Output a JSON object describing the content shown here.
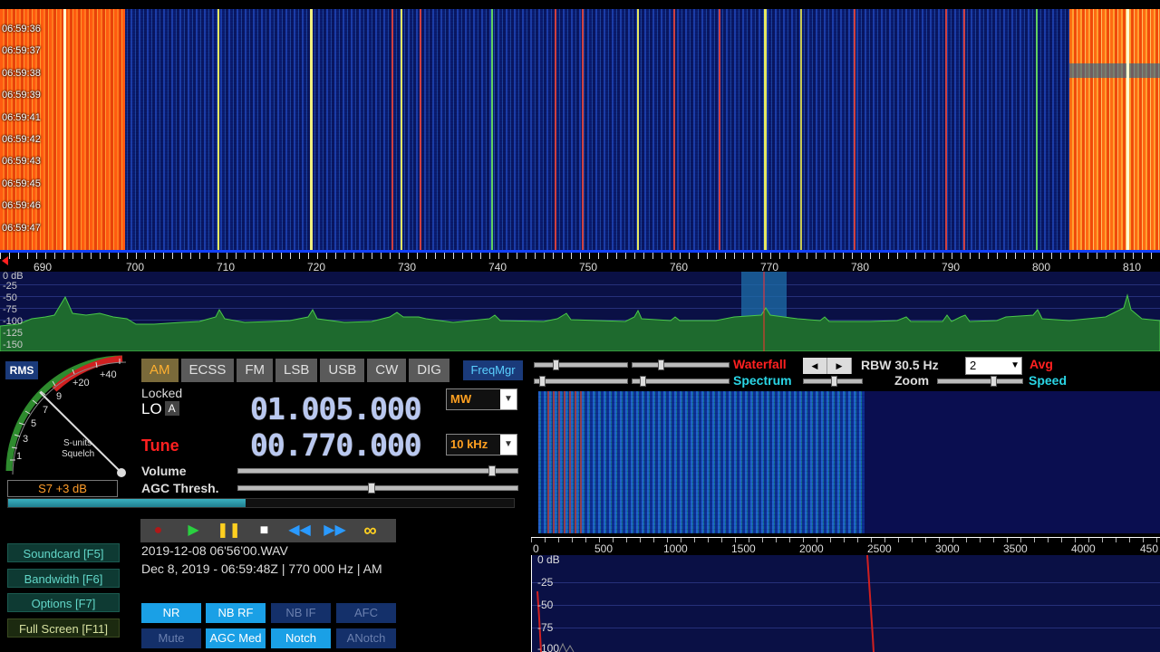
{
  "waterfall": {
    "timestamps": [
      "06:59:36",
      "06:59:37",
      "06:59:38",
      "06:59:39",
      "06:59:41",
      "06:59:42",
      "06:59:43",
      "06:59:45",
      "06:59:46",
      "06:59:47"
    ],
    "freq_labels": [
      "690",
      "700",
      "710",
      "720",
      "730",
      "740",
      "750",
      "760",
      "770",
      "780",
      "790",
      "800",
      "810"
    ]
  },
  "spectrum": {
    "y_labels": [
      "0 dB",
      "-25",
      "-50",
      "-75",
      "-100",
      "-125",
      "-150"
    ]
  },
  "meter": {
    "rms_label": "RMS",
    "scale_labels": [
      "+40",
      "+20",
      "9",
      "7",
      "5",
      "3",
      "1"
    ],
    "caption_line1": "S-units",
    "caption_line2": "Squelch",
    "readout": "S7 +3 dB",
    "level_percent": 47
  },
  "modes": {
    "items": [
      "AM",
      "ECSS",
      "FM",
      "LSB",
      "USB",
      "CW",
      "DIG"
    ],
    "active": "AM",
    "freqmgr": "FreqMgr"
  },
  "receiver": {
    "locked": "Locked",
    "lo_label": "LO",
    "lo_badge": "A",
    "lo_freq": "01.005.000",
    "band_select": "MW",
    "tune_label": "Tune",
    "tune_freq": "00.770.000",
    "step_select": "10 kHz",
    "volume_label": "Volume",
    "agc_label": "AGC Thresh."
  },
  "side_buttons": [
    "Soundcard [F5]",
    "Bandwidth [F6]",
    "Options   [F7]",
    "Full Screen [F11]"
  ],
  "file": {
    "name": "2019-12-08 06'56'00.WAV",
    "info": "Dec 8, 2019 - 06:59:48Z | 770 000 Hz | AM"
  },
  "dsp": {
    "row1": [
      "NR",
      "NB RF",
      "NB IF",
      "AFC"
    ],
    "row2": [
      "Mute",
      "AGC Med",
      "Notch",
      "ANotch"
    ]
  },
  "audio": {
    "waterfall_label": "Waterfall",
    "spectrum_label": "Spectrum",
    "rbw": "RBW 30.5 Hz",
    "avg_value": "2",
    "avg_label": "Avg",
    "zoom_label": "Zoom",
    "speed_label": "Speed",
    "freq_labels": [
      "0",
      "500",
      "1000",
      "1500",
      "2000",
      "2500",
      "3000",
      "3500",
      "4000",
      "450"
    ],
    "y_labels": [
      "0 dB",
      "-25",
      "-50",
      "-75",
      "-100"
    ]
  },
  "colors": {
    "accent_red": "#ff2020",
    "accent_cyan": "#2ad6e6",
    "tab_active": "#ffb030",
    "freq_digits": "#b9c8f0"
  }
}
